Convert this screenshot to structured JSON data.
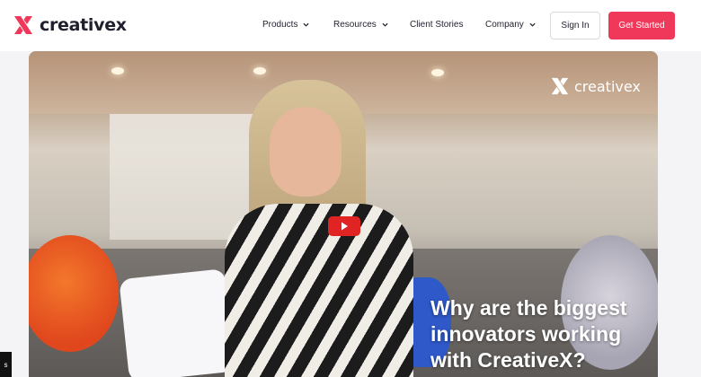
{
  "brand": {
    "name": "creativex"
  },
  "nav": {
    "items": [
      {
        "label": "Products",
        "has_menu": true
      },
      {
        "label": "Resources",
        "has_menu": true
      },
      {
        "label": "Client Stories",
        "has_menu": false
      },
      {
        "label": "Company",
        "has_menu": true
      }
    ],
    "sign_in": "Sign In",
    "get_started": "Get Started"
  },
  "video": {
    "overlay_logo": "creativex",
    "caption": "Why are the biggest innovators working with CreativeX?",
    "play_icon": "youtube-play-icon"
  },
  "side_tab": {
    "label": "s"
  },
  "colors": {
    "accent": "#f0385a",
    "text": "#1f1f2e",
    "play": "#e02424"
  }
}
